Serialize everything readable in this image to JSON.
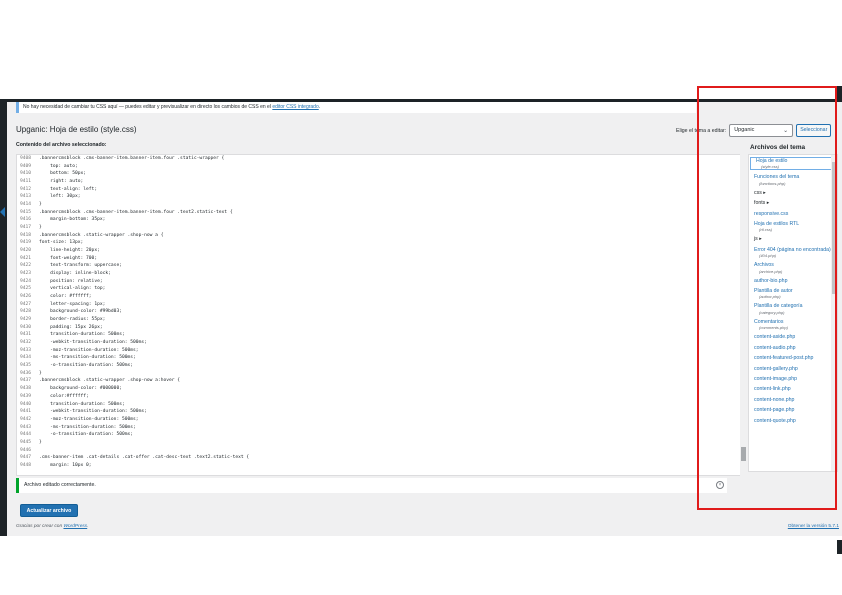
{
  "notice": {
    "text": "No hay necesidad de cambiar tu CSS aquí — puedes editar y previsualizar en directo los cambios de CSS en el",
    "link": "editor CSS integrado",
    "suffix": "."
  },
  "page": {
    "title": "Upganic: Hoja de estilo (style.css)",
    "subtitle": "Contenido del archivo seleccionado:"
  },
  "theme_selector": {
    "label": "Elige el tema a editar:",
    "value": "Upganic",
    "button": "Seleccionar"
  },
  "code_lines": [
    {
      "n": "9408",
      "t": ".bannercmsblock .cms-banner-item.banner-item.four .static-wrapper {"
    },
    {
      "n": "9409",
      "t": "    top: auto;"
    },
    {
      "n": "9410",
      "t": "    bottom: 50px;"
    },
    {
      "n": "9411",
      "t": "    right: auto;"
    },
    {
      "n": "9412",
      "t": "    text-align: left;"
    },
    {
      "n": "9413",
      "t": "    left: 30px;"
    },
    {
      "n": "9414",
      "t": "}"
    },
    {
      "n": "9415",
      "t": ".bannercmsblock .cms-banner-item.banner-item.four .text2.static-text {"
    },
    {
      "n": "9416",
      "t": "    margin-bottom: 35px;"
    },
    {
      "n": "9417",
      "t": "}"
    },
    {
      "n": "9418",
      "t": ".bannercmsblock .static-wrapper .shop-now a {"
    },
    {
      "n": "9419",
      "t": "font-size: 13px;"
    },
    {
      "n": "9420",
      "t": "    line-height: 20px;"
    },
    {
      "n": "9421",
      "t": "    font-weight: 700;"
    },
    {
      "n": "9422",
      "t": "    text-transform: uppercase;"
    },
    {
      "n": "9423",
      "t": "    display: inline-block;"
    },
    {
      "n": "9424",
      "t": "    position: relative;"
    },
    {
      "n": "9425",
      "t": "    vertical-align: top;"
    },
    {
      "n": "9426",
      "t": "    color: #ffffff;"
    },
    {
      "n": "9427",
      "t": "    letter-spacing: 1px;"
    },
    {
      "n": "9428",
      "t": "    background-color: #99bd03;"
    },
    {
      "n": "9429",
      "t": "    border-radius: 55px;"
    },
    {
      "n": "9430",
      "t": "    padding: 15px 26px;"
    },
    {
      "n": "9431",
      "t": "    transition-duration: 500ms;"
    },
    {
      "n": "9432",
      "t": "    -webkit-transition-duration: 500ms;"
    },
    {
      "n": "9433",
      "t": "    -moz-transition-duration: 500ms;"
    },
    {
      "n": "9434",
      "t": "    -ms-transition-duration: 500ms;"
    },
    {
      "n": "9435",
      "t": "    -o-transition-duration: 500ms;"
    },
    {
      "n": "9436",
      "t": "}"
    },
    {
      "n": "9437",
      "t": ".bannercmsblock .static-wrapper .shop-now a:hover {"
    },
    {
      "n": "9438",
      "t": "    background-color: #000000;"
    },
    {
      "n": "9439",
      "t": "    color:#ffffff;"
    },
    {
      "n": "9440",
      "t": "    transition-duration: 500ms;"
    },
    {
      "n": "9441",
      "t": "    -webkit-transition-duration: 500ms;"
    },
    {
      "n": "9442",
      "t": "    -moz-transition-duration: 500ms;"
    },
    {
      "n": "9443",
      "t": "    -ms-transition-duration: 500ms;"
    },
    {
      "n": "9444",
      "t": "    -o-transition-duration: 500ms;"
    },
    {
      "n": "9445",
      "t": "}"
    },
    {
      "n": "9446",
      "t": ""
    },
    {
      "n": "9447",
      "t": ".cms-banner-item .cat-details .cat-offer .cat-desc-text .text2.static-text {"
    },
    {
      "n": "9448",
      "t": "    margin: 10px 0;"
    }
  ],
  "sidebar": {
    "title": "Archivos del tema",
    "files": [
      {
        "label": "Hoja de estilo",
        "sub": "(style.css)",
        "active": true,
        "folder": false
      },
      {
        "label": "Funciones del tema",
        "sub": "(functions.php)",
        "active": false,
        "folder": false
      },
      {
        "label": "css ▸",
        "sub": "",
        "active": false,
        "folder": true
      },
      {
        "label": "fonts ▸",
        "sub": "",
        "active": false,
        "folder": true
      },
      {
        "label": "responsive.css",
        "sub": "",
        "active": false,
        "folder": false
      },
      {
        "label": "Hoja de estilos RTL",
        "sub": "(rtl.css)",
        "active": false,
        "folder": false
      },
      {
        "label": "js ▸",
        "sub": "",
        "active": false,
        "folder": true
      },
      {
        "label": "Error 404 (página no encontrada)",
        "sub": "(404.php)",
        "active": false,
        "folder": false
      },
      {
        "label": "Archivos",
        "sub": "(archive.php)",
        "active": false,
        "folder": false
      },
      {
        "label": "author-bio.php",
        "sub": "",
        "active": false,
        "folder": false
      },
      {
        "label": "Plantilla de autor",
        "sub": "(author.php)",
        "active": false,
        "folder": false
      },
      {
        "label": "Plantilla de categoría",
        "sub": "(category.php)",
        "active": false,
        "folder": false
      },
      {
        "label": "Comentarios",
        "sub": "(comments.php)",
        "active": false,
        "folder": false
      },
      {
        "label": "content-aside.php",
        "sub": "",
        "active": false,
        "folder": false
      },
      {
        "label": "content-audio.php",
        "sub": "",
        "active": false,
        "folder": false
      },
      {
        "label": "content-featured-post.php",
        "sub": "",
        "active": false,
        "folder": false
      },
      {
        "label": "content-gallery.php",
        "sub": "",
        "active": false,
        "folder": false
      },
      {
        "label": "content-image.php",
        "sub": "",
        "active": false,
        "folder": false
      },
      {
        "label": "content-link.php",
        "sub": "",
        "active": false,
        "folder": false
      },
      {
        "label": "content-none.php",
        "sub": "",
        "active": false,
        "folder": false
      },
      {
        "label": "content-page.php",
        "sub": "",
        "active": false,
        "folder": false
      },
      {
        "label": "content-quote.php",
        "sub": "",
        "active": false,
        "folder": false
      }
    ]
  },
  "success_notice": "Archivo editado correctamente.",
  "update_button": "Actualizar archivo",
  "footer": {
    "thanks": "Gracias por crear con",
    "wp_link": "WordPress",
    "thanks_suffix": ".",
    "version": "Obtener la versión 5.7.1"
  },
  "colors": {
    "accent": "#2271b1",
    "highlight_box": "#e01b1b",
    "success": "#00a32a"
  }
}
